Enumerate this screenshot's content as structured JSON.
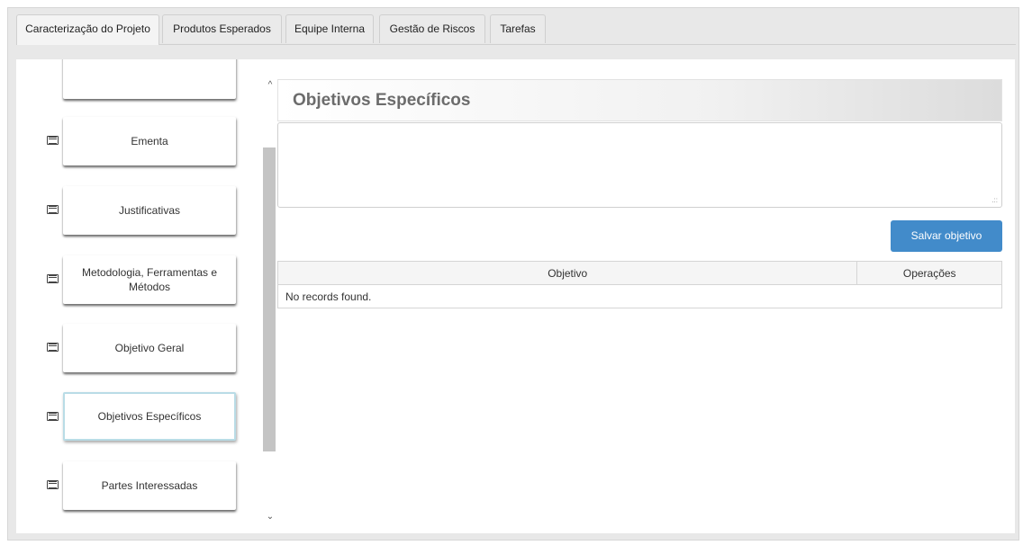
{
  "tabs": [
    {
      "label": "Caracterização do Projeto",
      "active": true
    },
    {
      "label": "Produtos Esperados",
      "active": false
    },
    {
      "label": "Equipe Interna",
      "active": false
    },
    {
      "label": "Gestão de Riscos",
      "active": false
    },
    {
      "label": "Tarefas",
      "active": false
    }
  ],
  "sections": [
    {
      "label": "",
      "icon": "",
      "selected": false
    },
    {
      "label": "Ementa",
      "icon": "list-icon",
      "selected": false
    },
    {
      "label": "Justificativas",
      "icon": "list-icon",
      "selected": false
    },
    {
      "label": "Metodologia, Ferramentas e Métodos",
      "icon": "list-icon",
      "selected": false
    },
    {
      "label": "Objetivo Geral",
      "icon": "list-icon",
      "selected": false
    },
    {
      "label": "Objetivos Específicos",
      "icon": "list-icon",
      "selected": true
    },
    {
      "label": "Partes Interessadas",
      "icon": "list-icon",
      "selected": false
    }
  ],
  "scrollbar": {
    "up": "^",
    "down": "⌄"
  },
  "panel": {
    "title": "Objetivos Específicos",
    "textarea_value": "",
    "save_label": "Salvar objetivo",
    "grip": ".::"
  },
  "table": {
    "columns": [
      "Objetivo",
      "Operações"
    ],
    "empty_message": "No records found."
  },
  "colors": {
    "primary_button": "#428bca",
    "selected_border": "#b9dce6"
  }
}
